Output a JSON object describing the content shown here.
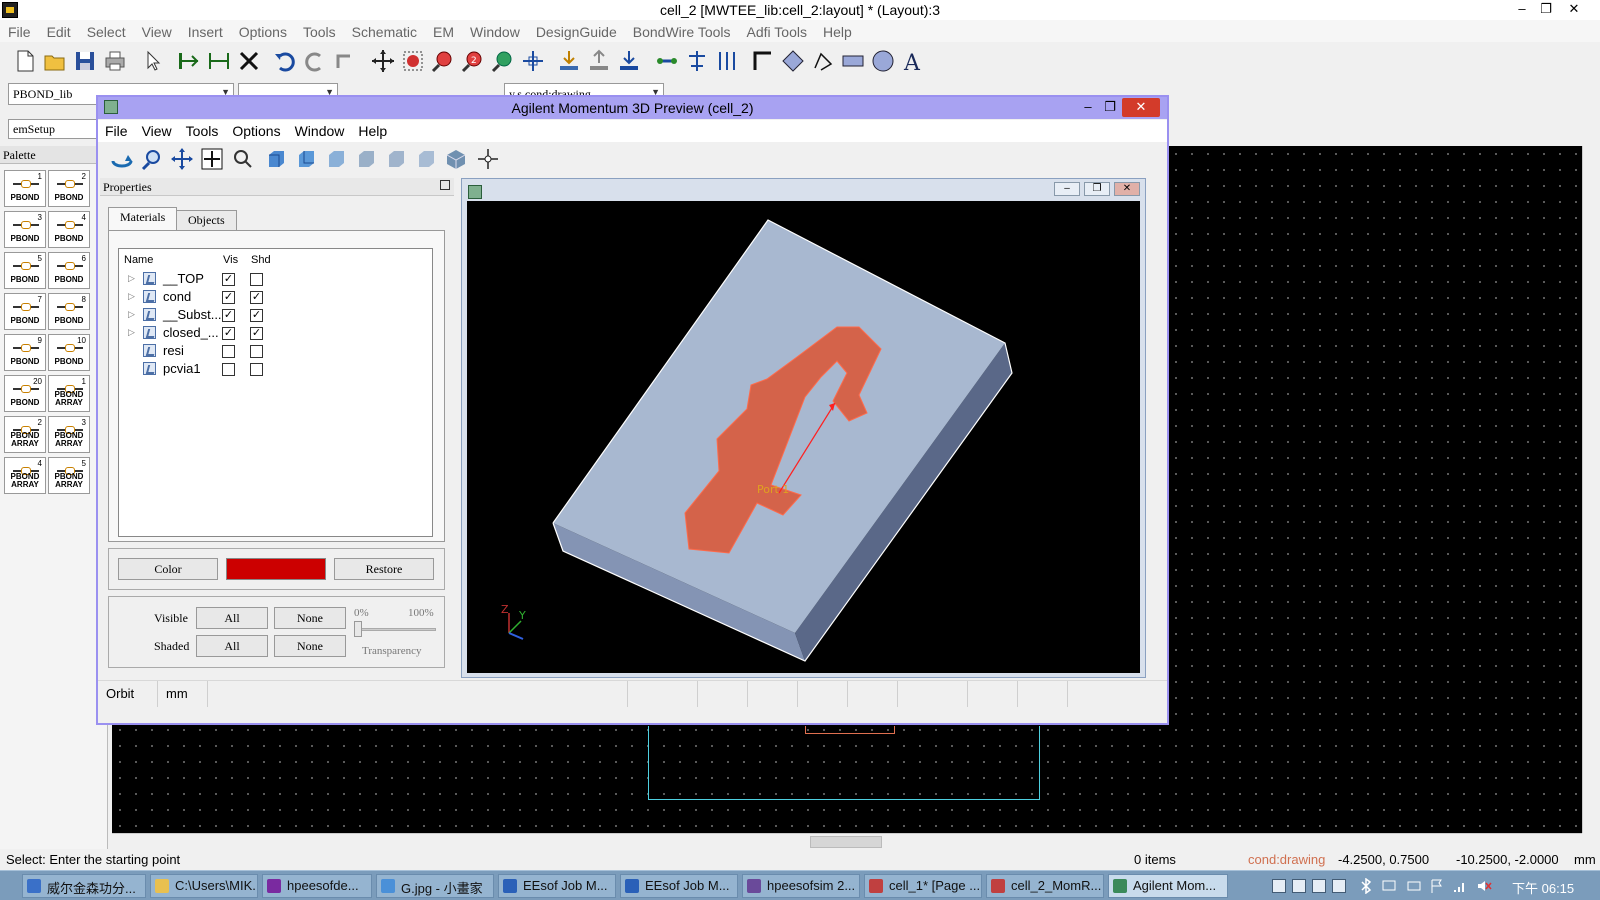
{
  "window": {
    "title": "cell_2 [MWTEE_lib:cell_2:layout] * (Layout):3",
    "controls": [
      "–",
      "❐",
      "✕"
    ]
  },
  "menubar": [
    "File",
    "Edit",
    "Select",
    "View",
    "Insert",
    "Options",
    "Tools",
    "Schematic",
    "EM",
    "Window",
    "DesignGuide",
    "BondWire Tools",
    "Adfi Tools",
    "Help"
  ],
  "toolbar2": {
    "library_combo": "PBOND_lib",
    "layer_combo": "y.s.cond:drawing",
    "emsetup_combo": "emSetup"
  },
  "palette": {
    "title": "Palette",
    "items": [
      {
        "num": "1",
        "label": "PBOND"
      },
      {
        "num": "2",
        "label": "PBOND"
      },
      {
        "num": "3",
        "label": "PBOND"
      },
      {
        "num": "4",
        "label": "PBOND"
      },
      {
        "num": "5",
        "label": "PBOND"
      },
      {
        "num": "6",
        "label": "PBOND"
      },
      {
        "num": "7",
        "label": "PBOND"
      },
      {
        "num": "8",
        "label": "PBOND"
      },
      {
        "num": "9",
        "label": "PBOND"
      },
      {
        "num": "10",
        "label": "PBOND"
      },
      {
        "num": "20",
        "label": "PBOND"
      },
      {
        "num": "1",
        "label": "PBOND ARRAY"
      },
      {
        "num": "2",
        "label": "PBOND ARRAY"
      },
      {
        "num": "3",
        "label": "PBOND ARRAY"
      },
      {
        "num": "4",
        "label": "PBOND ARRAY"
      },
      {
        "num": "5",
        "label": "PBOND ARRAY"
      }
    ]
  },
  "statusbar": {
    "prompt": "Select: Enter the starting point",
    "items": "0 items",
    "layer": "cond:drawing",
    "coord1": "-4.2500, 0.7500",
    "coord2": "-10.2500, -2.0000",
    "unit": "mm"
  },
  "taskbar": {
    "tasks": [
      {
        "label": "威尔金森功分...",
        "color": "#3a70c8"
      },
      {
        "label": "C:\\Users\\MIK...",
        "color": "#e8c050"
      },
      {
        "label": "hpeesofde...",
        "color": "#7a2aa0"
      },
      {
        "label": "G.jpg - 小畫家",
        "color": "#4a90d8"
      },
      {
        "label": "EEsof Job M...",
        "color": "#2a60b8"
      },
      {
        "label": "EEsof Job M...",
        "color": "#2a60b8"
      },
      {
        "label": "hpeesofsim 2...",
        "color": "#6a4a9a"
      },
      {
        "label": "cell_1* [Page ...",
        "color": "#c04040"
      },
      {
        "label": "cell_2_MomR...",
        "color": "#c04040"
      },
      {
        "label": "Agilent Mom...",
        "color": "#3a8a5a"
      }
    ],
    "clock": "下午 06:15"
  },
  "preview": {
    "title": "Agilent Momentum 3D Preview (cell_2)",
    "menu": [
      "File",
      "View",
      "Tools",
      "Options",
      "Window",
      "Help"
    ],
    "properties": {
      "title": "Properties",
      "tabs": [
        "Materials",
        "Objects"
      ],
      "columns": [
        "Name",
        "Vis",
        "Shd"
      ],
      "materials": [
        {
          "name": "__TOP",
          "expandable": true,
          "vis": true,
          "shd": false
        },
        {
          "name": "cond",
          "expandable": true,
          "vis": true,
          "shd": true
        },
        {
          "name": "__Subst...",
          "expandable": true,
          "vis": true,
          "shd": true
        },
        {
          "name": "closed_...",
          "expandable": true,
          "vis": true,
          "shd": true
        },
        {
          "name": "resi",
          "expandable": false,
          "vis": false,
          "shd": false
        },
        {
          "name": "pcvia1",
          "expandable": false,
          "vis": false,
          "shd": false
        }
      ],
      "color_button": "Color",
      "restore_button": "Restore",
      "selected_color": "#cc0000",
      "visible_label": "Visible",
      "shaded_label": "Shaded",
      "all_label": "All",
      "none_label": "None",
      "transparency_min": "0%",
      "transparency_max": "100%",
      "transparency_label": "Transparency",
      "transparency_value": 0
    },
    "viewport": {
      "port_label": "Port 1",
      "axis_labels": [
        "Z",
        "Y"
      ],
      "colors": {
        "substrate": "#a8b8d0",
        "conductor": "#d4634a",
        "port": "#ff2020",
        "edges": "#ffffff"
      }
    },
    "status": {
      "mode": "Orbit",
      "unit": "mm"
    }
  }
}
